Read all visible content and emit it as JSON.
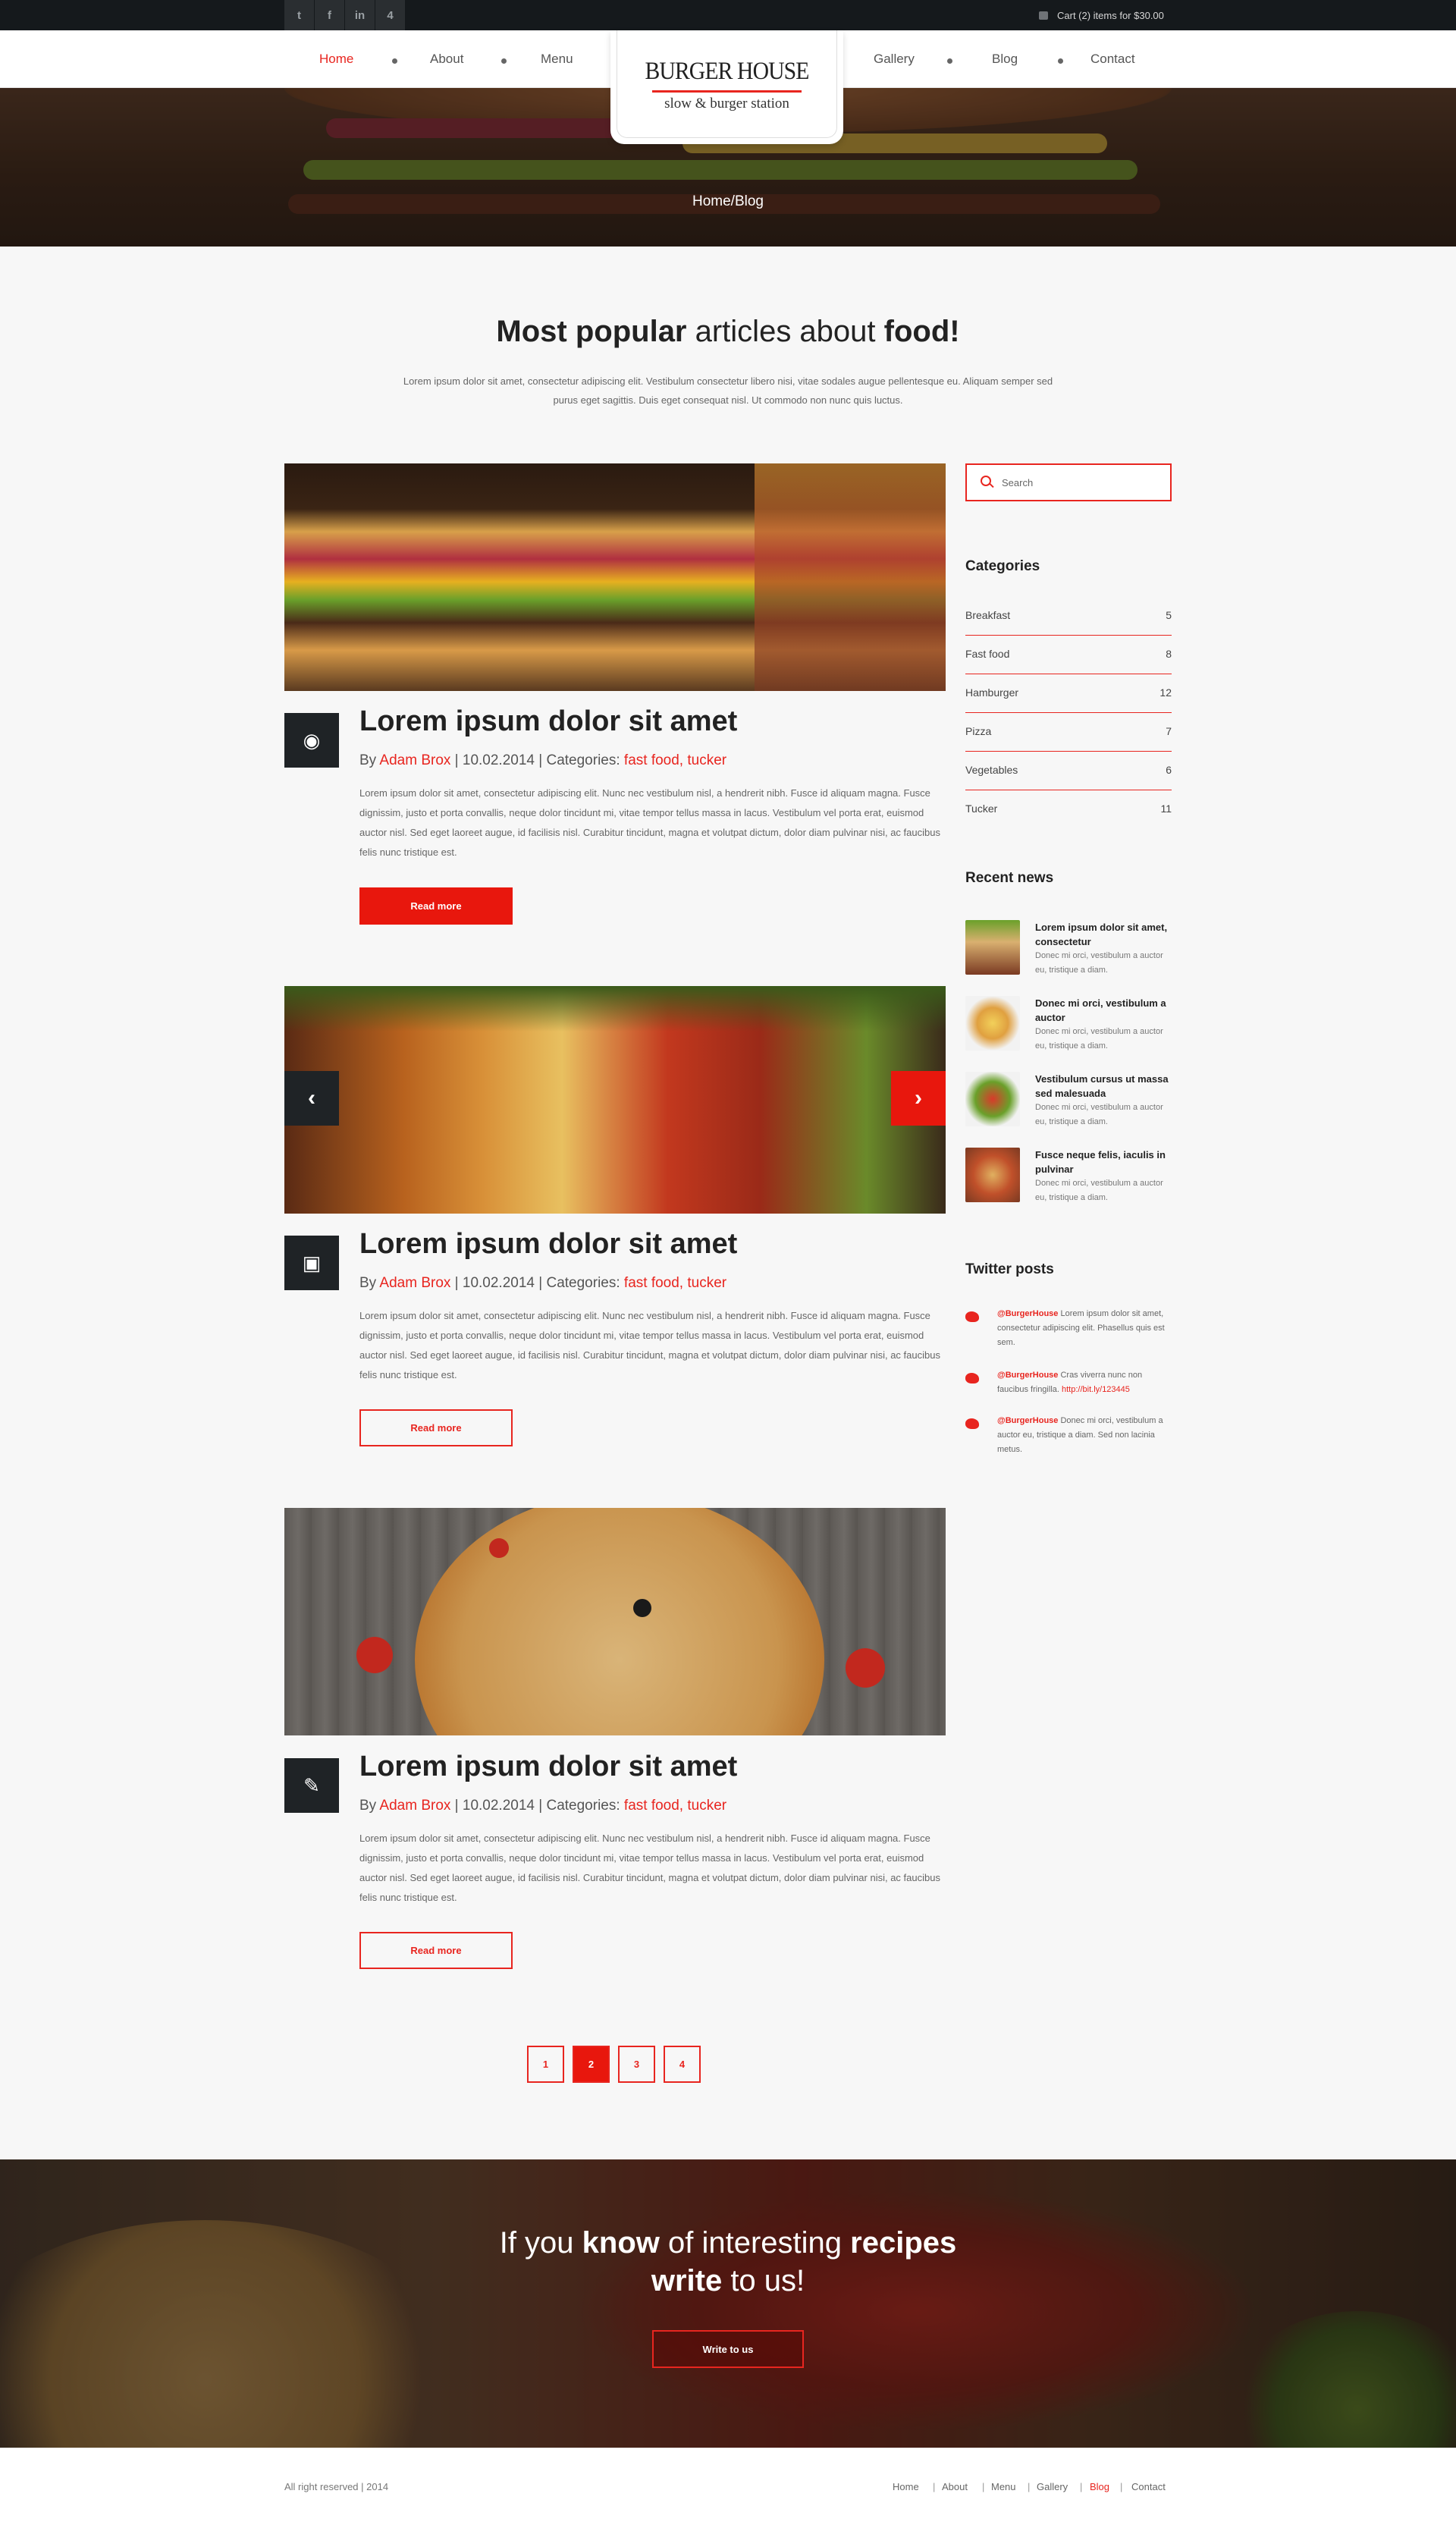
{
  "topbar": {
    "social": [
      {
        "icon": "twitter-icon",
        "glyph": "t"
      },
      {
        "icon": "facebook-icon",
        "glyph": "f"
      },
      {
        "icon": "linkedin-icon",
        "glyph": "in"
      },
      {
        "icon": "foursquare-icon",
        "glyph": "4"
      }
    ],
    "cart_text": "Cart (2) items for $30.00"
  },
  "nav": {
    "left": [
      "Home",
      "About",
      "Menu"
    ],
    "right": [
      "Gallery",
      "Blog",
      "Contact"
    ],
    "active": "Home"
  },
  "logo": {
    "title": "BURGER HOUSE",
    "subtitle": "slow & burger station"
  },
  "hero": {
    "breadcrumb": "Home/Blog"
  },
  "intro": {
    "heading_b1": "Most popular",
    "heading_mid": " articles about ",
    "heading_b2": "food!",
    "text": "Lorem ipsum dolor sit amet, consectetur adipiscing elit. Vestibulum consectetur libero nisi, vitae sodales augue pellentesque eu. Aliquam semper sed purus eget sagittis. Duis eget consequat nisl. Ut commodo non nunc quis luctus."
  },
  "posts": [
    {
      "icon": "camera-icon",
      "title": "Lorem ipsum dolor sit amet",
      "by": "By ",
      "author": "Adam Brox",
      "date": " | 10.02.2014 | Categories: ",
      "categories": "fast food, tucker",
      "text": "Lorem ipsum dolor sit amet, consectetur adipiscing elit. Nunc nec vestibulum nisl, a hendrerit nibh. Fusce id aliquam magna. Fusce dignissim, justo et porta convallis, neque dolor tincidunt mi, vitae tempor tellus massa in lacus. Vestibulum vel porta erat, euismod auctor nisl. Sed eget laoreet augue, id facilisis nisl. Curabitur tincidunt, magna et volutpat dictum, dolor diam pulvinar nisi, ac faucibus felis nunc tristique est.",
      "button": "Read more"
    },
    {
      "icon": "gallery-icon",
      "title": "Lorem ipsum dolor sit amet",
      "by": "By ",
      "author": "Adam Brox",
      "date": " | 10.02.2014 | Categories: ",
      "categories": "fast food, tucker",
      "text": "Lorem ipsum dolor sit amet, consectetur adipiscing elit. Nunc nec vestibulum nisl, a hendrerit nibh. Fusce id aliquam magna. Fusce dignissim, justo et porta convallis, neque dolor tincidunt mi, vitae tempor tellus massa in lacus. Vestibulum vel porta erat, euismod auctor nisl. Sed eget laoreet augue, id facilisis nisl. Curabitur tincidunt, magna et volutpat dictum, dolor diam pulvinar nisi, ac faucibus felis nunc tristique est.",
      "button": "Read more"
    },
    {
      "icon": "pencil-icon",
      "title": "Lorem ipsum dolor sit amet",
      "by": "By ",
      "author": "Adam Brox",
      "date": " | 10.02.2014 | Categories: ",
      "categories": "fast food, tucker",
      "text": "Lorem ipsum dolor sit amet, consectetur adipiscing elit. Nunc nec vestibulum nisl, a hendrerit nibh. Fusce id aliquam magna. Fusce dignissim, justo et porta convallis, neque dolor tincidunt mi, vitae tempor tellus massa in lacus. Vestibulum vel porta erat, euismod auctor nisl. Sed eget laoreet augue, id facilisis nisl. Curabitur tincidunt, magna et volutpat dictum, dolor diam pulvinar nisi, ac faucibus felis nunc tristique est.",
      "button": "Read more"
    }
  ],
  "pagination": {
    "pages": [
      "1",
      "2",
      "3",
      "4"
    ],
    "current": "2"
  },
  "sidebar": {
    "search_placeholder": "Search",
    "categories_title": "Categories",
    "categories": [
      {
        "name": "Breakfast",
        "count": "5"
      },
      {
        "name": "Fast food",
        "count": "8"
      },
      {
        "name": "Hamburger",
        "count": "12"
      },
      {
        "name": "Pizza",
        "count": "7"
      },
      {
        "name": "Vegetables",
        "count": "6"
      },
      {
        "name": "Tucker",
        "count": "11"
      }
    ],
    "news_title": "Recent news",
    "news": [
      {
        "title": "Lorem ipsum dolor sit amet, consectetur",
        "text": "Donec mi orci, vestibulum a auctor eu, tristique a diam."
      },
      {
        "title": "Donec mi orci, vestibulum a auctor",
        "text": "Donec mi orci, vestibulum a auctor eu, tristique a diam."
      },
      {
        "title": "Vestibulum cursus ut massa sed malesuada",
        "text": "Donec mi orci, vestibulum a auctor eu, tristique a diam."
      },
      {
        "title": "Fusce neque felis, iaculis in pulvinar",
        "text": "Donec mi orci, vestibulum a auctor eu, tristique a diam."
      }
    ],
    "twitter_title": "Twitter posts",
    "tweets": [
      {
        "handle": "@BurgerHouse",
        "text": " Lorem ipsum dolor sit amet, consectetur adipiscing elit. Phasellus quis est sem.",
        "link": ""
      },
      {
        "handle": "@BurgerHouse",
        "text": " Cras viverra nunc non faucibus fringilla. ",
        "link": "http://bit.ly/123445"
      },
      {
        "handle": "@BurgerHouse",
        "text": " Donec mi orci, vestibulum a auctor eu, tristique a diam. Sed non lacinia metus.",
        "link": ""
      }
    ]
  },
  "cta": {
    "l1a": "If you ",
    "l1b": "know",
    "l1c": " of interesting ",
    "l1d": "recipes",
    "l2a": "write",
    "l2b": " to us!",
    "button": "Write to us"
  },
  "footer": {
    "copyright": "All right reserved | 2014",
    "links": [
      "Home",
      "About",
      "Menu",
      "Gallery",
      "Blog",
      "Contact"
    ],
    "active": "Blog"
  },
  "colors": {
    "accent": "#e8251f",
    "dark": "#1f2326",
    "topbar": "#15191c"
  }
}
